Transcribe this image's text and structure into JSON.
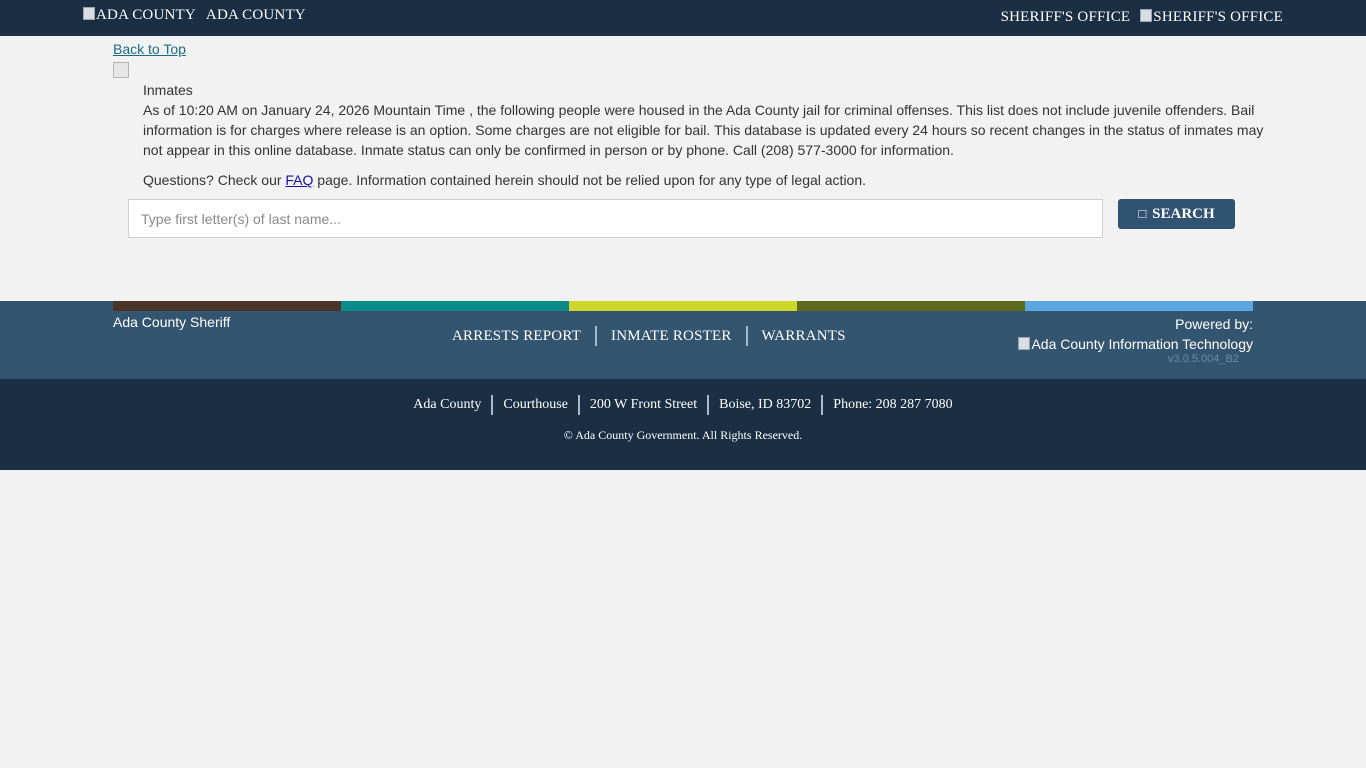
{
  "header": {
    "left_logo_alt": "ADA COUNTY",
    "left_title": "ADA COUNTY",
    "right_title": "SHERIFF'S OFFICE",
    "right_logo_alt": "SHERIFF'S OFFICE"
  },
  "page": {
    "back_to_top": "Back to Top",
    "heading": "Inmates",
    "intro": "As of 10:20 AM on January 24, 2026 Mountain Time , the following people were housed in the Ada County jail for criminal offenses. This list does not include juvenile offenders. Bail information is for charges where release is an option. Some charges are not eligible for bail. This database is updated every 24 hours so recent changes in the status of inmates may not appear in this online database. Inmate status can only be confirmed in person or by phone. Call (208) 577-3000 for information.",
    "questions_prefix": "Questions? Check our ",
    "faq_link": "FAQ",
    "questions_suffix": " page. Information contained herein should not be relied upon for any type of legal action."
  },
  "search": {
    "placeholder": "Type first letter(s) of last name...",
    "value": "",
    "button_icon": "search-icon",
    "button_label": "SEARCH"
  },
  "footer": {
    "stripe_colors": [
      "#4a3428",
      "#0b8a8a",
      "#cfd62a",
      "#5e6b1e",
      "#5aa6de"
    ],
    "org_name": "Ada County Sheriff",
    "nav": [
      {
        "label": "ARRESTS REPORT"
      },
      {
        "label": "INMATE ROSTER"
      },
      {
        "label": "WARRANTS"
      }
    ],
    "powered_by": "Powered by:",
    "it_logo_alt": "Ada County Information Technology",
    "version": "v3.0.5.004_B2",
    "address": {
      "county": "Ada County",
      "building": "Courthouse",
      "street": "200 W Front Street",
      "city": "Boise, ID 83702",
      "phone": "Phone: 208 287 7080"
    },
    "copyright": "© Ada County Government. All Rights Reserved."
  },
  "colors": {
    "header_bg": "#1b2f44",
    "footer_top_bg": "#34556f",
    "button_bg": "#2f5370",
    "link": "#1a6c86"
  }
}
